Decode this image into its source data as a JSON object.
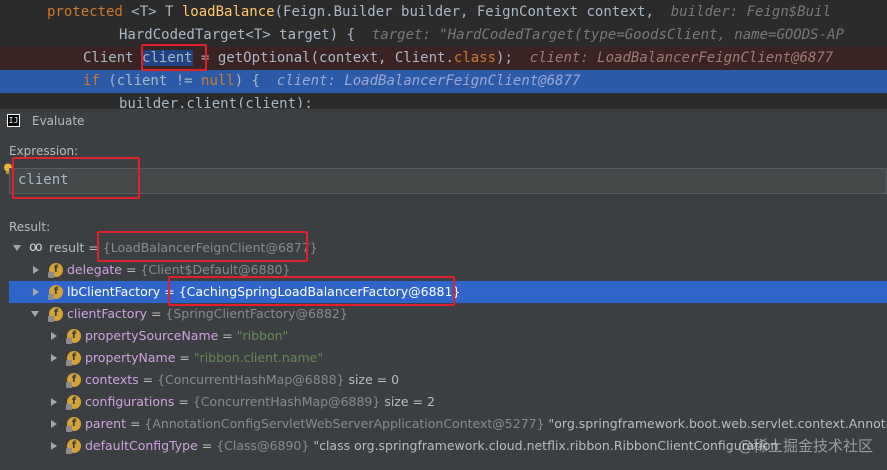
{
  "editor": {
    "line1": {
      "kw": "protected",
      "generic": " <T> T ",
      "method": "loadBalance",
      "params": "(Feign.Builder builder, FeignContext context,",
      "hint": "builder: Feign$Buil"
    },
    "line2": {
      "text": "HardCodedTarget<T> target) {",
      "hint": "target: \"HardCodedTarget(type=GoodsClient, name=GOODS-AP"
    },
    "line3": {
      "type": "Client ",
      "var": "client",
      "rest": " = getOptional(context, Client.",
      "kw": "class",
      "end": ");",
      "hint": "client: LoadBalancerFeignClient@6877"
    },
    "line4": {
      "kw": "if",
      "mid": " (client != ",
      "null": "null",
      "end": ") {",
      "hint": "client: LoadBalancerFeignClient@6877"
    },
    "line5": {
      "text": "builder.client(client);"
    }
  },
  "evaluate": {
    "title": "Evaluate",
    "expression_label": "Expression:",
    "expression_value": "client",
    "result_label": "Result:"
  },
  "tree": [
    {
      "name": "result",
      "eq": " = ",
      "value": "{LoadBalancerFeignClient@6877}",
      "icon": "watch-icon"
    },
    {
      "name": "delegate",
      "eq": " = ",
      "value": "{Client$Default@6880}",
      "icon": "field-icon"
    },
    {
      "name": "lbClientFactory",
      "eq": " = ",
      "value": "{CachingSpringLoadBalancerFactory@6881}",
      "icon": "field-icon"
    },
    {
      "name": "clientFactory",
      "eq": " = ",
      "value": "{SpringClientFactory@6882}",
      "icon": "field-icon"
    },
    {
      "name": "propertySourceName",
      "eq": " = ",
      "value": "\"ribbon\"",
      "icon": "field-icon"
    },
    {
      "name": "propertyName",
      "eq": " = ",
      "value": "\"ribbon.client.name\"",
      "icon": "field-icon"
    },
    {
      "name": "contexts",
      "eq": " = ",
      "value": "{ConcurrentHashMap@6888}",
      "extra": "  size = 0",
      "icon": "field-icon"
    },
    {
      "name": "configurations",
      "eq": " = ",
      "value": "{ConcurrentHashMap@6889}",
      "extra": "  size = 2",
      "icon": "field-icon"
    },
    {
      "name": "parent",
      "eq": " = ",
      "value": "{AnnotationConfigServletWebServerApplicationContext@5277}",
      "extra": " \"org.springframework.boot.web.servlet.context.Annotatio",
      "icon": "field-icon"
    },
    {
      "name": "defaultConfigType",
      "eq": " = ",
      "value": "{Class@6890}",
      "extra": " \"class org.springframework.cloud.netflix.ribbon.RibbonClientConfiguration",
      "icon": "field-icon"
    }
  ],
  "watermark": "@稀土掘金技术社区",
  "colors": {
    "highlight_red": "#e0202a",
    "selection_blue": "#2f65ca",
    "field_icon": "#d6a236"
  }
}
